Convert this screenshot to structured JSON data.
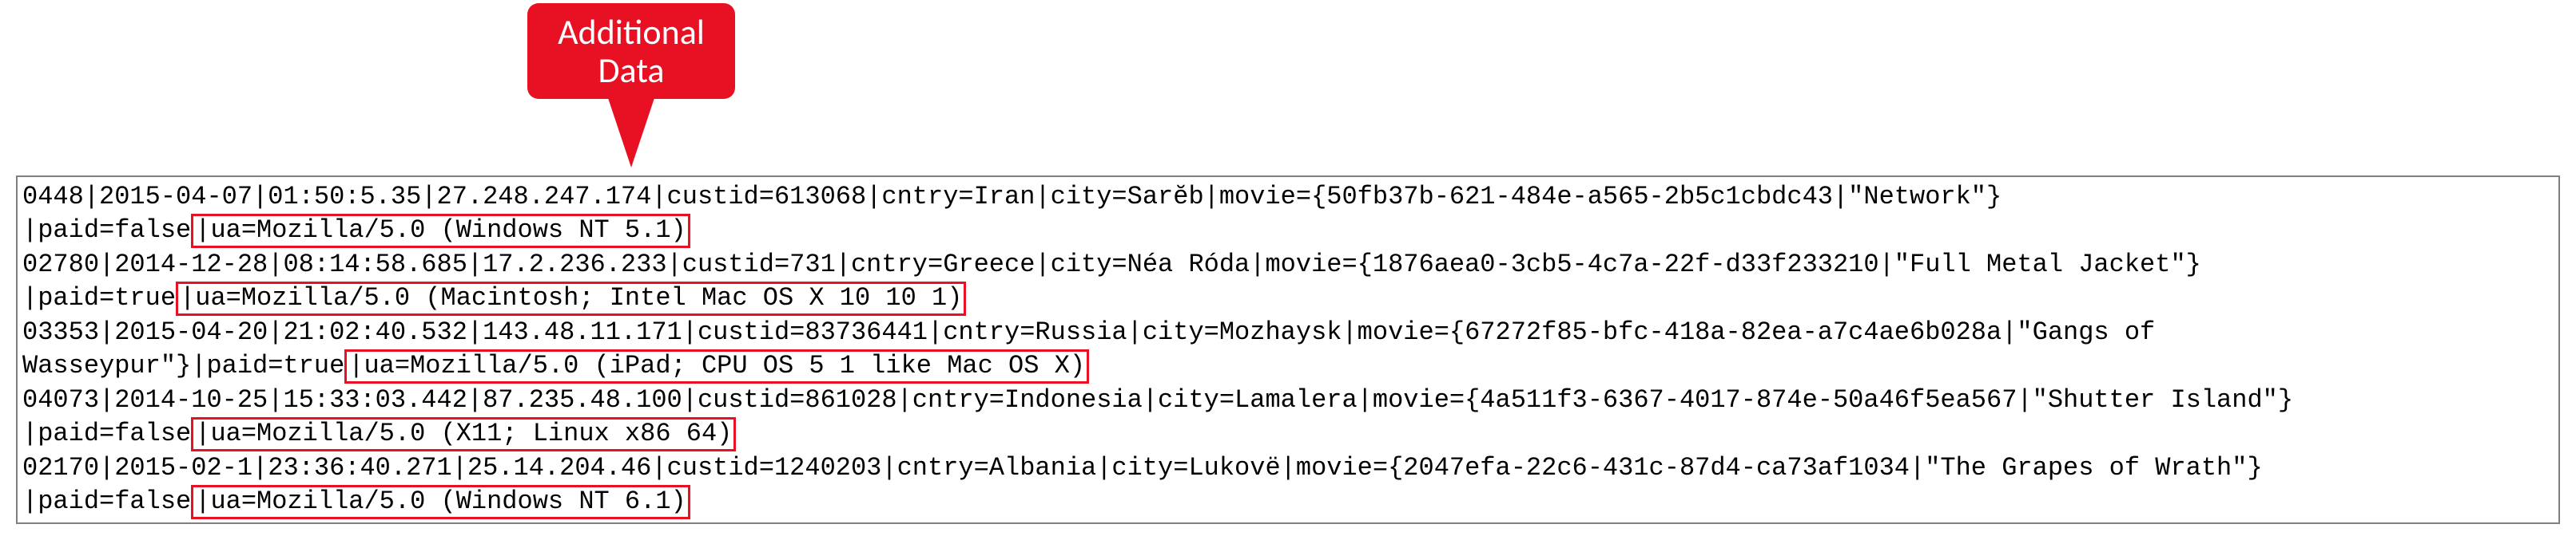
{
  "callout": {
    "line1": "Additional",
    "line2": "Data"
  },
  "log": {
    "lines": [
      {
        "pre": "0448|2015-04-07|01:50:5.35|27.248.247.174|custid=613068|cntry=Iran|city=Sarĕb|movie={50fb37b-621-484e-a565-2b5c1cbdc43|\"Network\"}",
        "paid": "|paid=false",
        "ua": "|ua=Mozilla/5.0 (Windows NT 5.1)"
      },
      {
        "pre": "02780|2014-12-28|08:14:58.685|17.2.236.233|custid=731|cntry=Greece|city=Néa Róda|movie={1876aea0-3cb5-4c7a-22f-d33f233210|\"Full Metal Jacket\"}",
        "paid": "|paid=true",
        "ua": "|ua=Mozilla/5.0 (Macintosh; Intel Mac OS X 10 10 1)"
      },
      {
        "pre": "03353|2015-04-20|21:02:40.532|143.48.11.171|custid=83736441|cntry=Russia|city=Mozhaysk|movie={67272f85-bfc-418a-82ea-a7c4ae6b028a|\"Gangs of",
        "pre2": "Wasseypur\"}|paid=true",
        "ua": "|ua=Mozilla/5.0 (iPad; CPU OS 5 1 like Mac OS X)"
      },
      {
        "pre": "04073|2014-10-25|15:33:03.442|87.235.48.100|custid=861028|cntry=Indonesia|city=Lamalera|movie={4a511f3-6367-4017-874e-50a46f5ea567|\"Shutter Island\"}",
        "paid": "|paid=false",
        "ua": "|ua=Mozilla/5.0 (X11; Linux x86 64)"
      },
      {
        "pre": "02170|2015-02-1|23:36:40.271|25.14.204.46|custid=1240203|cntry=Albania|city=Lukovë|movie={2047efa-22c6-431c-87d4-ca73af1034|\"The Grapes of Wrath\"}",
        "paid": "|paid=false",
        "ua": "|ua=Mozilla/5.0 (Windows NT 6.1)"
      }
    ]
  }
}
